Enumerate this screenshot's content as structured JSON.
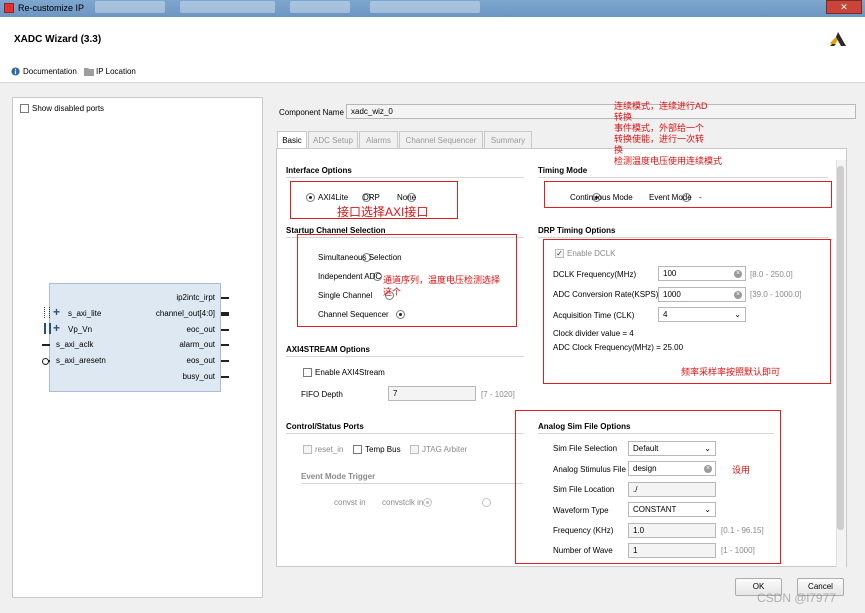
{
  "window": {
    "title": "Re-customize IP",
    "close": "✕"
  },
  "header": {
    "title": "XADC Wizard (3.3)"
  },
  "toolbar": {
    "documentation": "Documentation",
    "ip_location": "IP Location"
  },
  "left": {
    "show_disabled_ports": "Show disabled ports",
    "ports_left": [
      "s_axi_lite",
      "Vp_Vn",
      "s_axi_aclk",
      "s_axi_aresetn"
    ],
    "ports_right": [
      "ip2intc_irpt",
      "channel_out[4:0]",
      "eoc_out",
      "alarm_out",
      "eos_out",
      "busy_out"
    ]
  },
  "component": {
    "label": "Component Name",
    "value": "xadc_wiz_0"
  },
  "tabs": [
    "Basic",
    "ADC Setup",
    "Alarms",
    "Channel Sequencer",
    "Summary"
  ],
  "interface": {
    "title": "Interface Options",
    "options": [
      "AXI4Lite",
      "DRP",
      "None"
    ],
    "selected": "AXI4Lite"
  },
  "timing": {
    "title": "Timing Mode",
    "options": [
      "Continuous Mode",
      "Event Mode"
    ],
    "selected": "Continuous Mode",
    "dash": "-"
  },
  "startup": {
    "title": "Startup Channel Selection",
    "options": [
      "Simultaneous Selection",
      "Independent ADC",
      "Single Channel",
      "Channel Sequencer"
    ],
    "selected": "Channel Sequencer"
  },
  "drp": {
    "title": "DRP Timing Options",
    "enable_dclk": "Enable DCLK",
    "dclk_label": "DCLK Frequency(MHz)",
    "dclk_value": "100",
    "dclk_range": "[8.0 - 250.0]",
    "adc_rate_label": "ADC Conversion Rate(KSPS)",
    "adc_rate_value": "1000",
    "adc_rate_range": "[39.0 - 1000.0]",
    "acq_label": "Acquisition Time (CLK)",
    "acq_value": "4",
    "clock_divider": "Clock divider value = 4",
    "adc_clock": "ADC Clock Frequency(MHz) = 25.00"
  },
  "axi4stream": {
    "title": "AXI4STREAM Options",
    "enable": "Enable AXI4Stream",
    "fifo_label": "FIFO Depth",
    "fifo_value": "7",
    "fifo_range": "[7 - 1020]"
  },
  "control": {
    "title": "Control/Status Ports",
    "reset_in": "reset_in",
    "temp_bus": "Temp Bus",
    "jtag_arbiter": "JTAG Arbiter"
  },
  "event_trigger": {
    "title": "Event Mode Trigger",
    "options": [
      "convst in",
      "convstclk in"
    ],
    "selected": "convst in"
  },
  "analog_sim": {
    "title": "Analog Sim File Options",
    "sim_file_selection_label": "Sim File Selection",
    "sim_file_selection_value": "Default",
    "stimulus_label": "Analog Stimulus File",
    "stimulus_value": "design",
    "location_label": "Sim File Location",
    "location_value": "./",
    "waveform_label": "Waveform Type",
    "waveform_value": "CONSTANT",
    "frequency_label": "Frequency (KHz)",
    "frequency_value": "1.0",
    "frequency_range": "[0.1 - 96.15]",
    "num_wave_label": "Number of Wave",
    "num_wave_value": "1",
    "num_wave_range": "[1 - 1000]"
  },
  "annotations": {
    "top_right": [
      "连续模式，连续进行AD",
      "转换",
      "事件模式，外部给一个",
      "转换使能，进行一次转",
      "换",
      "检测温度电压使用连续模式"
    ],
    "interface": "接口选择AXI接口",
    "startup": [
      "通道序列，温度电压检测选择",
      "这个"
    ],
    "drp": "频率采样率按照默认即可",
    "sim": "设用"
  },
  "buttons": {
    "ok": "OK",
    "cancel": "Cancel"
  },
  "watermark": "CSDN @l7977",
  "colors": {
    "annotation_red": "#e01010",
    "ip_block": "#dde8f3"
  }
}
